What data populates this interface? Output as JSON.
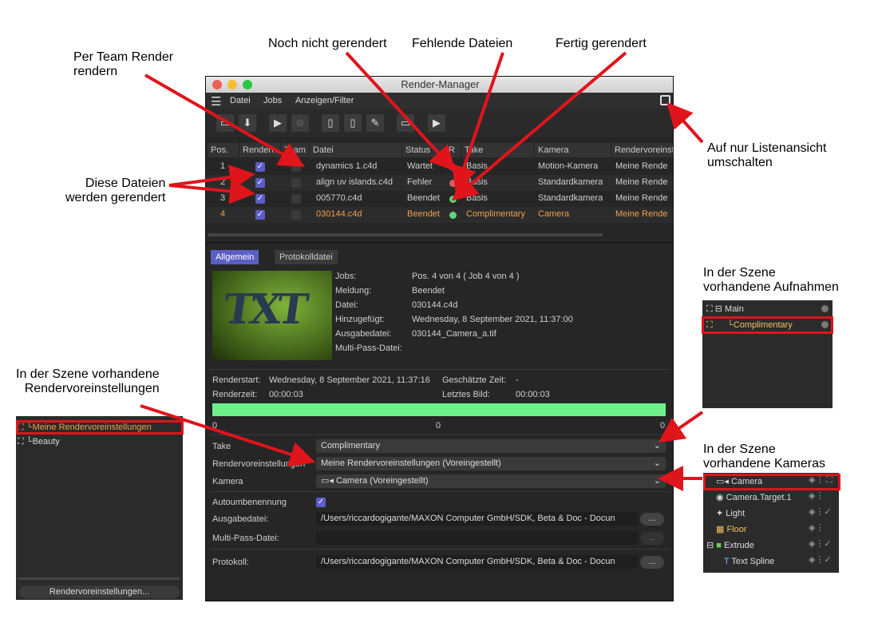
{
  "window": {
    "title": "Render-Manager",
    "menu": [
      "Datei",
      "Jobs",
      "Anzeigen/Filter"
    ]
  },
  "columns": [
    "Pos.",
    "Rendern",
    "Team",
    "Datei",
    "Status",
    "R",
    "Take",
    "Kamera",
    "Rendervoreinst"
  ],
  "rows": [
    {
      "pos": "1",
      "file": "dynamics 1.c4d",
      "status": "Wartet",
      "dot": "#777777",
      "take": "Basis",
      "camera": "Motion-Kamera",
      "preset": "Meine Rende"
    },
    {
      "pos": "2",
      "file": "align uv islands.c4d",
      "status": "Fehler",
      "dot": "#e25a5a",
      "take": "Basis",
      "camera": "Standardkamera",
      "preset": "Meine Rende"
    },
    {
      "pos": "3",
      "file": "005770.c4d",
      "status": "Beendet",
      "dot": "#5ed67a",
      "take": "Basis",
      "camera": "Standardkamera",
      "preset": "Meine Rende"
    },
    {
      "pos": "4",
      "file": "030144.c4d",
      "status": "Beendet",
      "dot": "#5ed67a",
      "take": "Complimentary",
      "camera": "Camera",
      "preset": "Meine Rende"
    }
  ],
  "tabs": {
    "general": "Allgemein",
    "log": "Protokolldatei"
  },
  "info": {
    "labels": [
      "Jobs:",
      "Meldung:",
      "Datei:",
      "Hinzugefügt:",
      "Ausgabedatei:",
      "Multi-Pass-Datei:"
    ],
    "values": [
      "Pos. 4 von 4 ( Job 4 von 4 )",
      "Beendet",
      "030144.c4d",
      "Wednesday, 8 September 2021, 11:37:00",
      "030144_Camera_a.tif",
      ""
    ],
    "thumb_text": "TXT"
  },
  "render": {
    "start_label": "Renderstart:",
    "start_value": "Wednesday, 8 September 2021, 11:37:16",
    "est_label": "Geschätzte Zeit:",
    "est_value": "-",
    "time_label": "Renderzeit:",
    "time_value": "00:00:03",
    "last_label": "Letztes Bild:",
    "last_value": "00:00:03",
    "progress": 1.0,
    "progress_color": "#6ef08a",
    "scale": [
      "0",
      "0",
      "0"
    ]
  },
  "settings": {
    "take_label": "Take",
    "take_value": "Complimentary",
    "preset_label": "Rendervoreinstellungen",
    "preset_value": "Meine Rendervoreinstellungen (Voreingestellt)",
    "camera_label": "Kamera",
    "camera_value": "Camera (Voreingestellt)",
    "rename_label": "Autoumbenennung",
    "output_label": "Ausgabedatei:",
    "output_value": "/Users/riccardogigante/MAXON Computer GmbH/SDK, Beta & Doc - Docun",
    "multipass_label": "Multi-Pass-Datei:",
    "log_label": "Protokoll:",
    "log_value": "/Users/riccardogigante/MAXON Computer GmbH/SDK, Beta & Doc - Docun",
    "browse": "..."
  },
  "left_panel": {
    "items": [
      "Meine Rendervoreinstellungen",
      "Beauty"
    ],
    "button": "Rendervoreinstellungen..."
  },
  "takes_panel": {
    "items": [
      "Main",
      "Complimentary"
    ]
  },
  "cameras_panel": {
    "items": [
      "Camera",
      "Camera.Target.1",
      "Light",
      "Floor",
      "Extrude",
      "Text Spline"
    ]
  },
  "annotations": {
    "team": "Per Team Render\nrendern",
    "not_rendered": "Noch nicht gerendert",
    "missing": "Fehlende Dateien",
    "done": "Fertig gerendert",
    "these_files": "Diese Dateien\nwerden gerendert",
    "list_view": "Auf nur Listenansicht\numschalten",
    "takes": "In der Szene\nvorhandene Aufnahmen",
    "presets": "In der Szene vorhandene\nRendervoreinstellungen",
    "cameras": "In der Szene\nvorhandene Kameras"
  },
  "colors": {
    "accent": "#f0a04b",
    "selection": "#5b5ec4",
    "arrow": "#e0141b"
  }
}
